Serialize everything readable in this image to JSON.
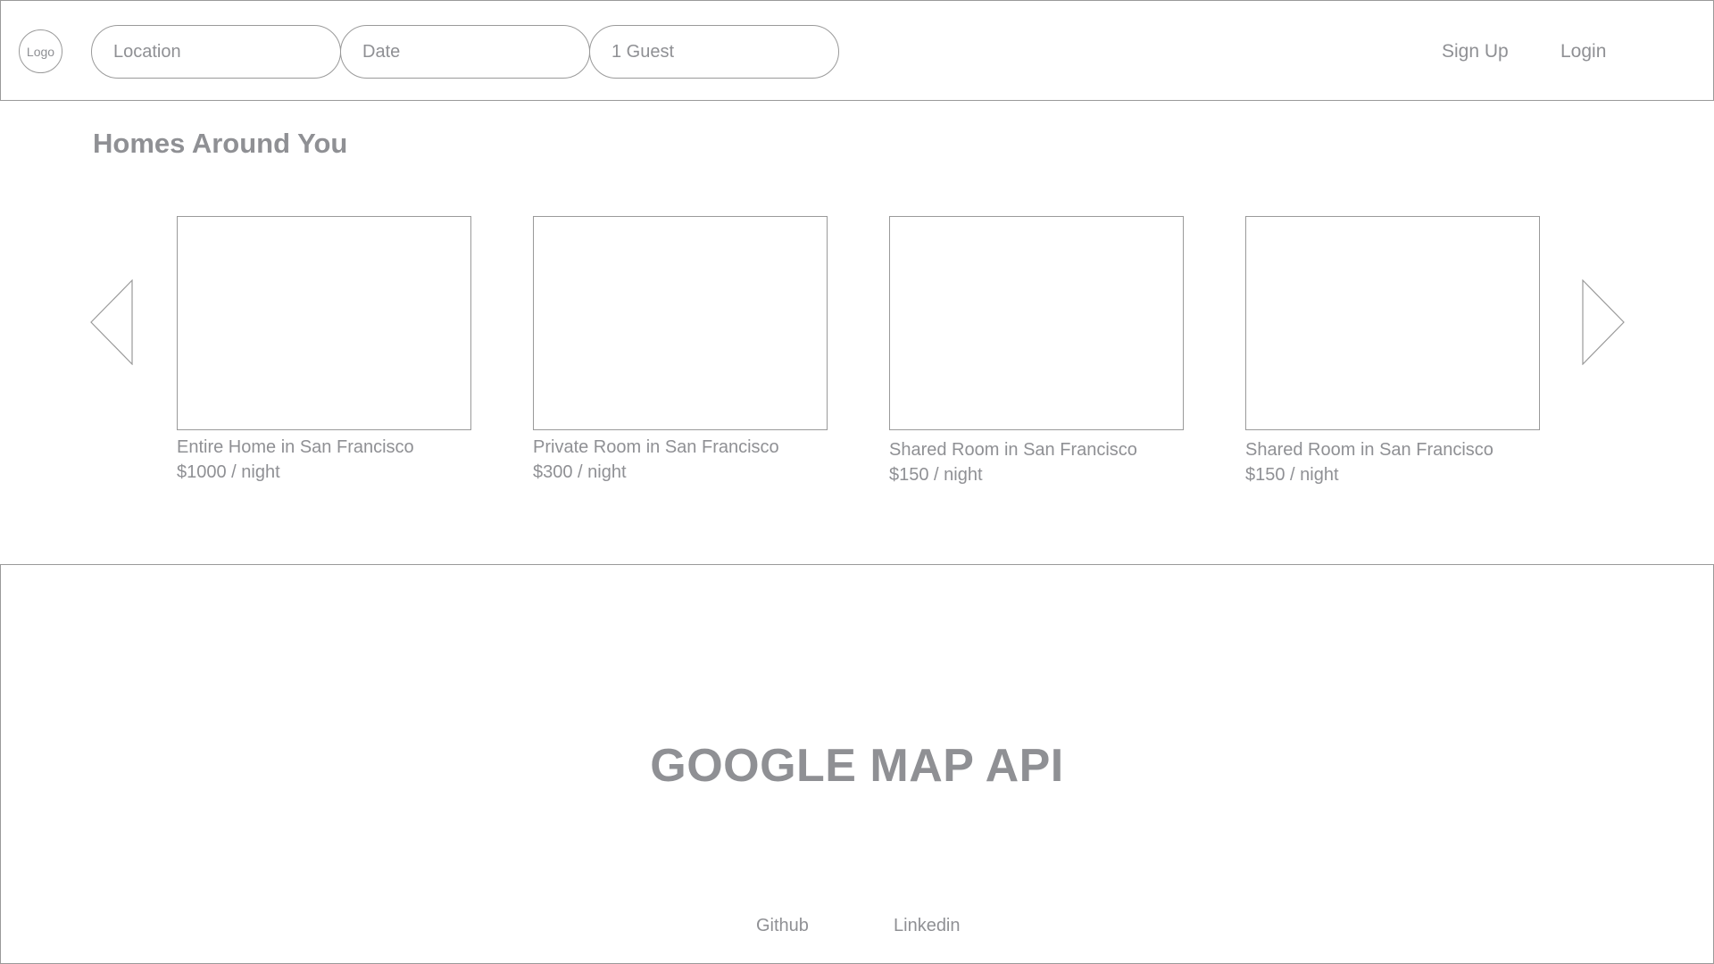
{
  "header": {
    "logo_text": "Logo",
    "search": {
      "location_placeholder": "Location",
      "date_placeholder": "Date",
      "guests_value": "1 Guest"
    },
    "nav": {
      "signup_label": "Sign Up",
      "login_label": "Login"
    }
  },
  "listings": {
    "title": "Homes Around You",
    "items": [
      {
        "title": "Entire Home in San Francisco",
        "price": "$1000 / night"
      },
      {
        "title": "Private Room in San Francisco",
        "price": "$300 / night"
      },
      {
        "title": "Shared Room in San Francisco",
        "price": "$150 / night"
      },
      {
        "title": "Shared Room in San Francisco",
        "price": "$150 / night"
      }
    ],
    "prev_icon": "triangle-left-icon",
    "next_icon": "triangle-right-icon"
  },
  "map": {
    "label": "GOOGLE MAP API"
  },
  "footer": {
    "github_label": "Github",
    "linkedin_label": "Linkedin"
  },
  "colors": {
    "text": "#8f9094",
    "border": "#9a9a9a",
    "background": "#ffffff"
  }
}
